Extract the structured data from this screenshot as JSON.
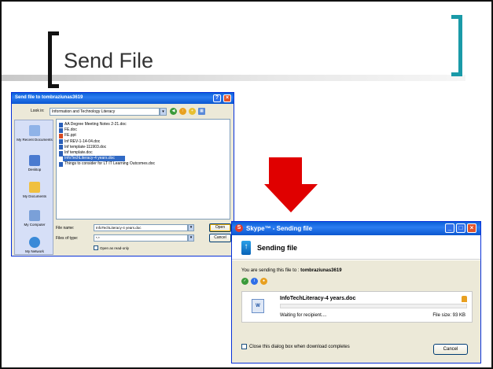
{
  "slide": {
    "title": "Send File"
  },
  "open_dialog": {
    "title": "Send file to tombraziunas3619",
    "lookin_label": "Look in:",
    "lookin_value": "Information and Technology Literacy",
    "places": [
      "My Recent Documents",
      "Desktop",
      "My Documents",
      "My Computer",
      "My Network"
    ],
    "files": [
      "AA Degree Meeting Notes 2-21.doc",
      "FE.doc",
      "FE.ppt",
      "Inf REV-1-14-04.doc",
      "Inf template-111903.doc",
      "Inf template.doc",
      "InfoTechLiteracy-4 years.doc",
      "Things to consider for LT IT Learning Outcomes.doc"
    ],
    "selected_file": "InfoTechLiteracy-4 years.doc",
    "filename_label": "File name:",
    "filename_value": "InfoTechLiteracy-4 years.doc",
    "filetype_label": "Files of type:",
    "filetype_value": "*.*",
    "readonly_label": "Open as read-only",
    "open_button": "Open",
    "cancel_button": "Cancel"
  },
  "skype_dialog": {
    "title": "Skype™ - Sending file",
    "heading": "Sending file",
    "sending_to_prefix": "You are sending this file to :",
    "recipient": "tombraziunas3619",
    "file_name": "InfoTechLiteracy-4 years.doc",
    "status": "Waiting for recipient....",
    "file_size": "File size: 93 KB",
    "progress": 0,
    "close_checkbox_label": "Close this dialog box when download completes",
    "cancel_button": "Cancel"
  },
  "colors": {
    "accent_teal": "#1a9aa8",
    "xp_blue": "#0a5fd8",
    "arrow_red": "#e00000"
  }
}
